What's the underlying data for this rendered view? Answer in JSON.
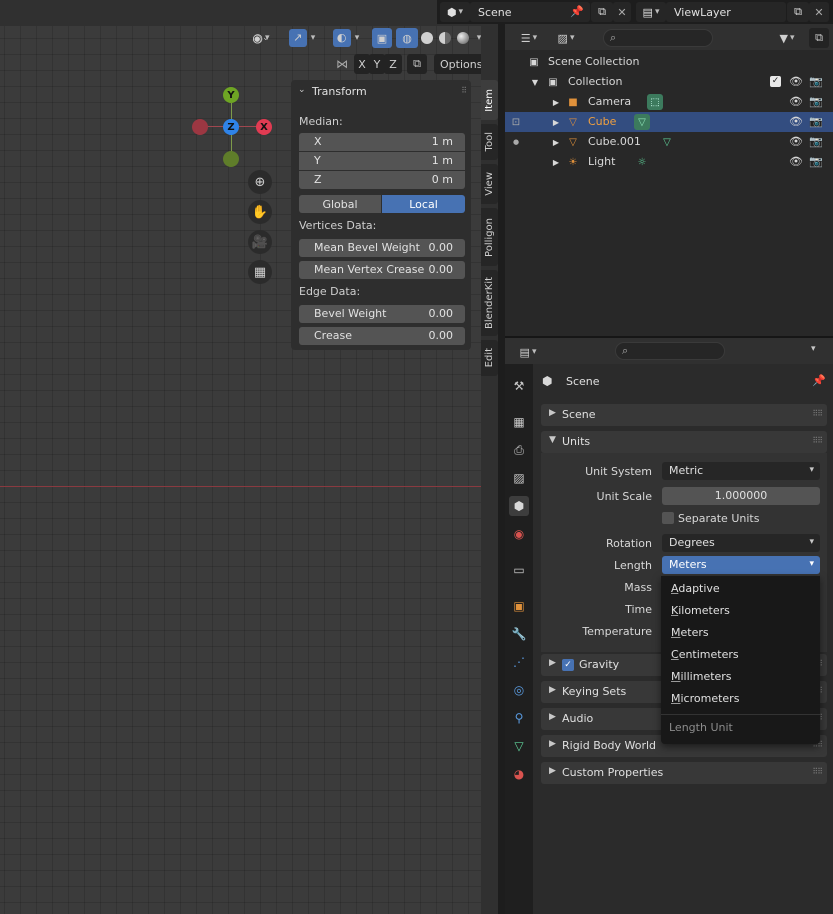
{
  "topbar": {
    "scene_label": "Scene",
    "viewlayer_label": "ViewLayer"
  },
  "viewport": {
    "header": {
      "axis_x": "X",
      "axis_y": "Y",
      "axis_z": "Z",
      "options_label": "Options"
    },
    "gizmo": {
      "x": "X",
      "y": "Y",
      "z": "Z"
    },
    "npanel": {
      "title": "Transform",
      "median_label": "Median:",
      "fields": [
        {
          "label": "X",
          "value": "1 m"
        },
        {
          "label": "Y",
          "value": "1 m"
        },
        {
          "label": "Z",
          "value": "0 m"
        }
      ],
      "global_label": "Global",
      "local_label": "Local",
      "vertices_label": "Vertices Data:",
      "mean_bevel_label": "Mean Bevel Weight",
      "mean_bevel_value": "0.00",
      "mean_crease_label": "Mean Vertex Crease",
      "mean_crease_value": "0.00",
      "edge_label": "Edge Data:",
      "bevel_label": "Bevel Weight",
      "bevel_value": "0.00",
      "crease_label": "Crease",
      "crease_value": "0.00"
    },
    "tabs": [
      "Item",
      "Tool",
      "View",
      "Polligon",
      "BlenderKit",
      "Edit"
    ]
  },
  "outliner": {
    "scene_collection": "Scene Collection",
    "collection": "Collection",
    "items": [
      {
        "name": "Camera"
      },
      {
        "name": "Cube"
      },
      {
        "name": "Cube.001"
      },
      {
        "name": "Light"
      }
    ]
  },
  "properties": {
    "context_title": "Scene",
    "sections": {
      "scene": "Scene",
      "units": "Units",
      "gravity": "Gravity",
      "keying_sets": "Keying Sets",
      "audio": "Audio",
      "rigid_body_world": "Rigid Body World",
      "custom_properties": "Custom Properties"
    },
    "units": {
      "unit_system_label": "Unit System",
      "unit_system_value": "Metric",
      "unit_scale_label": "Unit Scale",
      "unit_scale_value": "1.000000",
      "separate_units_label": "Separate Units",
      "rotation_label": "Rotation",
      "rotation_value": "Degrees",
      "length_label": "Length",
      "length_value": "Meters",
      "mass_label": "Mass",
      "time_label": "Time",
      "temperature_label": "Temperature"
    },
    "length_dropdown": {
      "options": [
        {
          "first": "A",
          "rest": "daptive"
        },
        {
          "first": "K",
          "rest": "ilometers"
        },
        {
          "first": "M",
          "rest": "eters"
        },
        {
          "first": "C",
          "rest": "entimeters"
        },
        {
          "first": "M",
          "rest": "illimeters"
        },
        {
          "first": "M",
          "rest": "icrometers"
        }
      ],
      "tooltip": "Length Unit"
    }
  },
  "colors": {
    "accent": "#4772b3",
    "selected_row": "#334d80",
    "gizmo_x": "#e13b52",
    "gizmo_y": "#6ea524",
    "gizmo_z": "#2f83e8"
  }
}
